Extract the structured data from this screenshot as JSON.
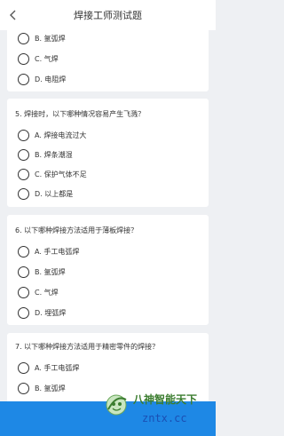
{
  "header": {
    "title": "焊接工师测试题"
  },
  "questions": [
    {
      "text": "",
      "options": [
        {
          "label": "B. 氩弧焊"
        },
        {
          "label": "C. 气焊"
        },
        {
          "label": "D. 电阻焊"
        }
      ]
    },
    {
      "text": "5. 焊接时，以下哪种情况容易产生飞溅？",
      "options": [
        {
          "label": "A. 焊接电流过大"
        },
        {
          "label": "B. 焊条潮湿"
        },
        {
          "label": "C. 保护气体不足"
        },
        {
          "label": "D. 以上都是"
        }
      ]
    },
    {
      "text": "6. 以下哪种焊接方法适用于薄板焊接？",
      "options": [
        {
          "label": "A. 手工电弧焊"
        },
        {
          "label": "B. 氩弧焊"
        },
        {
          "label": "C. 气焊"
        },
        {
          "label": "D. 埋弧焊"
        }
      ]
    },
    {
      "text": "7. 以下哪种焊接方法适用于精密零件的焊接？",
      "options": [
        {
          "label": "A. 手工电弧焊"
        },
        {
          "label": "B. 氩弧焊"
        }
      ]
    }
  ],
  "watermark": {
    "cn": "八神智能天下",
    "en": "zntx.cc"
  }
}
